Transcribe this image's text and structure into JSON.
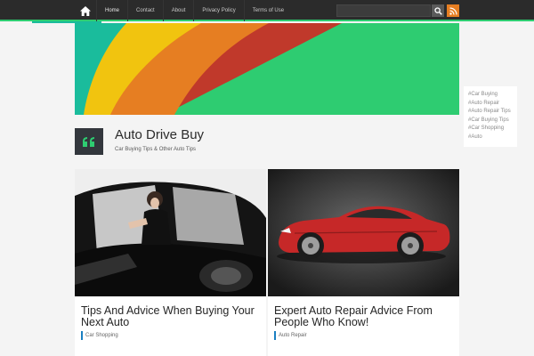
{
  "nav": {
    "items": [
      "Home",
      "Contact",
      "About",
      "Privacy Policy",
      "Terms of Use"
    ],
    "search_placeholder": "",
    "icons": {
      "home": "home-icon",
      "search": "search-icon",
      "rss": "rss-icon"
    }
  },
  "sidebar": {
    "tags": [
      "#Car Buying",
      "#Auto Repair",
      "#Auto Repair Tips",
      "#Car Buying Tips",
      "#Car Shopping",
      "#Auto"
    ]
  },
  "site": {
    "title": "Auto Drive Buy",
    "tagline": "Car Buying Tips & Other Auto Tips",
    "logo_icon": "quote-icon"
  },
  "posts": [
    {
      "title": "Tips And Advice When Buying Your Next Auto",
      "category": "Car Shopping"
    },
    {
      "title": "Expert Auto Repair Advice From People Who Know!",
      "category": "Auto Repair"
    }
  ],
  "colors": {
    "accent": "#2ecc71",
    "topbar": "#2b2b2b",
    "rss": "#e67e22",
    "category_bar": "#1a7fc1"
  }
}
